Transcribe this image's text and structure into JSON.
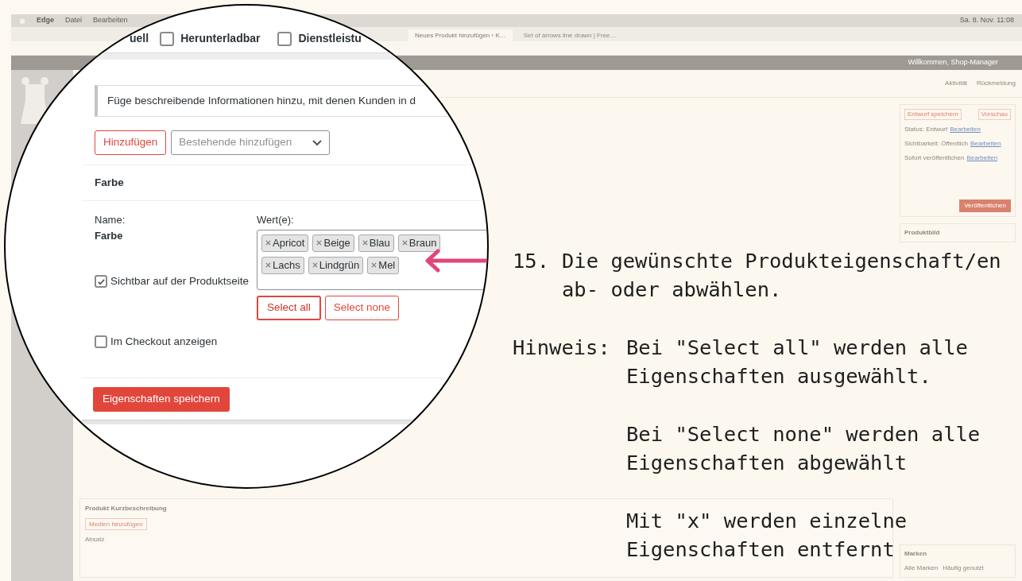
{
  "menu_bar": {
    "items": [
      "Edge",
      "Datei",
      "Bearbeiten"
    ],
    "clock": "Sa. 8. Nov. 11:08"
  },
  "browser_tabs": [
    {
      "title": "Neues Produkt hinzufügen ‹ K…",
      "selected": true
    },
    {
      "title": "Set of arrows line drawn | Free…",
      "selected": false
    }
  ],
  "admin_bar": {
    "greeting": "Willkommen, Shop-Manager"
  },
  "header_actions": [
    "Aktivität",
    "Rückmeldung"
  ],
  "publish_box": {
    "save_draft": "Entwurf speichern",
    "preview": "Vorschau",
    "rows": [
      {
        "text": "Status: Entwurf",
        "link": "Bearbeiten"
      },
      {
        "text": "Sichtbarkeit: Öffentlich",
        "link": "Bearbeiten"
      },
      {
        "text": "Sofort veröffentlichen",
        "link": "Bearbeiten"
      }
    ],
    "publish": "Veröffentlichen"
  },
  "product_image_panel": {
    "title": "Produktbild"
  },
  "brands_panel": {
    "title": "Marken",
    "tabs": [
      "Alle Marken",
      "Häufig genutzt"
    ]
  },
  "short_description": {
    "title": "Produkt Kurzbeschreibung",
    "media_button": "Medien hinzufügen",
    "format": "Absatz"
  },
  "magnifier": {
    "type_label": "uell",
    "type_options": [
      {
        "label": "Herunterladbar",
        "checked": false
      },
      {
        "label": "Dienstleistu",
        "checked": false
      }
    ],
    "notice": "Füge beschreibende Informationen hinzu, mit denen Kunden in d",
    "add_button": "Hinzufügen",
    "existing_select": {
      "placeholder": "Bestehende hinzufügen"
    },
    "attribute": {
      "title": "Farbe",
      "name_label": "Name:",
      "name": "Farbe",
      "values_label": "Wert(e):",
      "values": [
        "Apricot",
        "Beige",
        "Blau",
        "Braun",
        "Lachs",
        "Lindgrün",
        "Mel"
      ],
      "select_all": "Select all",
      "select_none": "Select none",
      "options": [
        {
          "label": "Sichtbar auf der Produktseite",
          "checked": true
        },
        {
          "label": "Im Checkout anzeigen",
          "checked": false
        }
      ]
    },
    "save_button": "Eigenschaften speichern"
  },
  "annotation": {
    "step": {
      "label": "15.",
      "lines": [
        "Die gewünschte Produkteigenschaft/en",
        "ab- oder abwählen."
      ]
    },
    "hint": {
      "label": "Hinweis:",
      "paragraphs": [
        [
          "Bei \"Select all\" werden alle",
          "Eigenschaften ausgewählt."
        ],
        [
          "Bei \"Select none\" werden alle",
          "Eigenschaften abgewählt"
        ],
        [
          "Mit \"x\" werden einzelne",
          "Eigenschaften entfernt"
        ]
      ]
    }
  }
}
